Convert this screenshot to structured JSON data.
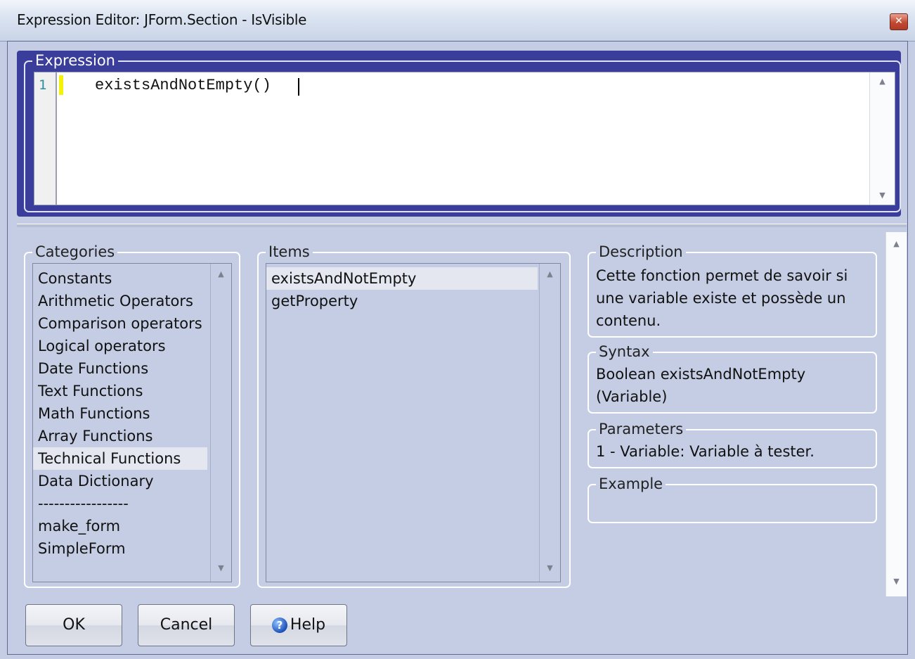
{
  "window": {
    "title": "Expression Editor: JForm.Section - IsVisible"
  },
  "expression": {
    "label": "Expression",
    "line_number": "1",
    "code": "existsAndNotEmpty()"
  },
  "categories": {
    "label": "Categories",
    "items": [
      "Constants",
      "Arithmetic Operators",
      "Comparison operators",
      "Logical operators",
      "Date Functions",
      "Text Functions",
      "Math Functions",
      "Array Functions",
      "Technical Functions",
      "Data Dictionary",
      "-----------------",
      "make_form",
      "SimpleForm"
    ],
    "selected": "Technical Functions"
  },
  "items": {
    "label": "Items",
    "list": [
      "existsAndNotEmpty",
      "getProperty"
    ],
    "selected": "existsAndNotEmpty"
  },
  "description": {
    "label": "Description",
    "lines": [
      "Cette fonction permet de savoir si",
      "une variable existe et possède un",
      "contenu."
    ]
  },
  "syntax": {
    "label": "Syntax",
    "lines": [
      "Boolean existsAndNotEmpty",
      "(Variable)"
    ]
  },
  "parameters": {
    "label": "Parameters",
    "lines": [
      "1 - Variable: Variable à tester."
    ]
  },
  "example": {
    "label": "Example",
    "lines": []
  },
  "buttons": {
    "ok": "OK",
    "cancel": "Cancel",
    "help": "Help"
  },
  "icons": {
    "close": "close-icon",
    "help": "help-icon",
    "scroll_up": "arrow-up-icon",
    "scroll_down": "arrow-down-icon"
  },
  "colors": {
    "expression_panel": "#3a3d9a",
    "background": "#c4cde3",
    "selection": "#e4e7f0",
    "change_marker": "#f2f20a"
  }
}
